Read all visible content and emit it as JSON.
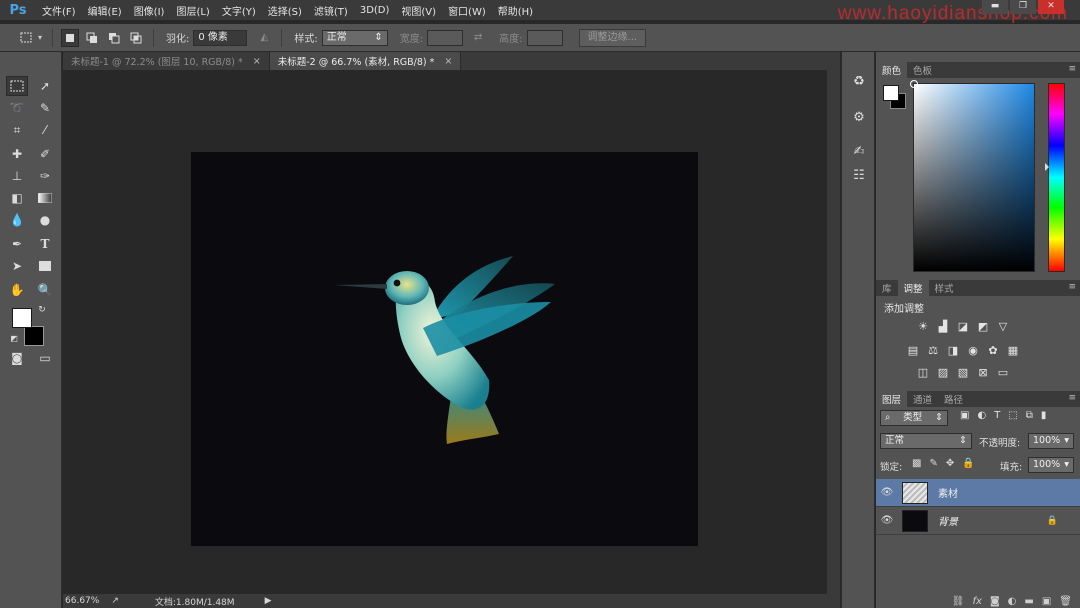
{
  "app": {
    "logo": "Ps",
    "watermark": "www.haoyidianshop.com"
  },
  "menu": [
    "文件(F)",
    "编辑(E)",
    "图像(I)",
    "图层(L)",
    "文字(Y)",
    "选择(S)",
    "滤镜(T)",
    "3D(D)",
    "视图(V)",
    "窗口(W)",
    "帮助(H)"
  ],
  "window_controls": {
    "minimize": "▬",
    "maximize": "❐",
    "close": "✕"
  },
  "options_bar": {
    "feather_label": "羽化:",
    "feather_value": "0 像素",
    "style_label": "样式:",
    "style_value": "正常",
    "width_label": "宽度:",
    "height_label": "高度:",
    "refine_edge_button": "调整边缘..."
  },
  "tabs": [
    {
      "label": "未标题-1 @ 72.2% (图层 10, RGB/8) *",
      "close": "×"
    },
    {
      "label": "未标题-2 @ 66.7% (素材, RGB/8) *",
      "close": "×"
    }
  ],
  "status_bar": {
    "zoom": "66.67%",
    "doc_size": "文档:1.80M/1.48M"
  },
  "color_panel": {
    "tabs": [
      "颜色",
      "色板"
    ],
    "foreground": "#ffffff",
    "background": "#000000",
    "hue_color": "#1e88e5"
  },
  "adjustments_panel": {
    "tabs": [
      "库",
      "调整",
      "样式"
    ],
    "title": "添加调整"
  },
  "layers_panel": {
    "tabs": [
      "图层",
      "通道",
      "路径"
    ],
    "filter_label": "类型",
    "blend_mode": "正常",
    "opacity_label": "不透明度:",
    "opacity_value": "100%",
    "lock_label": "锁定:",
    "fill_label": "填充:",
    "fill_value": "100%",
    "layers": [
      {
        "name": "素材",
        "selected": true
      },
      {
        "name": "背景",
        "locked": true
      }
    ]
  }
}
